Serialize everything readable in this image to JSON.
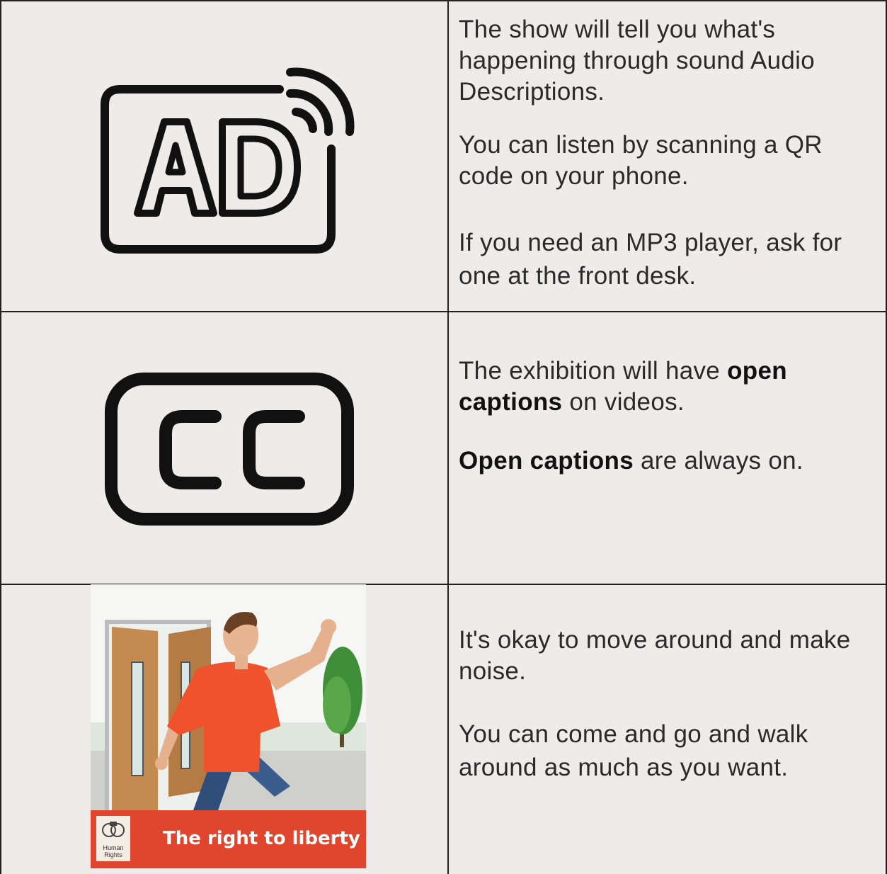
{
  "rows": [
    {
      "icon": "audio-description-icon",
      "paragraphs": [
        "The show will tell you what's happening through sound Audio Descriptions.",
        "You can listen by scanning a QR code on your phone.",
        "If you need an MP3 player, ask for one at the front desk."
      ]
    },
    {
      "icon": "closed-captions-icon",
      "p1_pre": "The exhibition will have ",
      "p1_bold": "open captions",
      "p1_post": " on videos.",
      "p2_bold": "Open captions",
      "p2_post": " are always on."
    },
    {
      "image": "man-walking-through-door-illustration",
      "banner_label": "The right to liberty",
      "badge_label": "Human Rights",
      "paragraphs": [
        "It's okay to move around and make noise.",
        "You can come and go and walk around as much as you want."
      ]
    }
  ],
  "colors": {
    "background": "#eeebea",
    "banner": "#e0452e",
    "shirt": "#f0522b"
  }
}
